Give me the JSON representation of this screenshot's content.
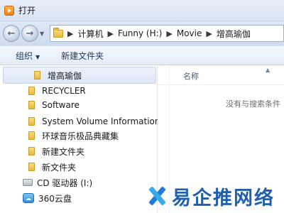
{
  "window": {
    "title": "打开"
  },
  "address": {
    "crumbs": [
      "计算机",
      "Funny (H:)",
      "Movie",
      "增高瑜伽"
    ]
  },
  "toolbar": {
    "organize_label": "组织",
    "new_folder_label": "新建文件夹"
  },
  "nav": {
    "items": [
      {
        "label": "增高瑜伽",
        "icon": "folder-icon",
        "selected": true
      },
      {
        "label": "RECYCLER",
        "icon": "folder-icon"
      },
      {
        "label": "Software",
        "icon": "folder-icon"
      },
      {
        "label": "System Volume Information",
        "icon": "folder-icon"
      },
      {
        "label": "环球音乐极品典藏集",
        "icon": "folder-icon"
      },
      {
        "label": "新建文件夹",
        "icon": "folder-icon"
      },
      {
        "label": "新文件夹",
        "icon": "folder-icon"
      },
      {
        "label": "CD 驱动器 (I:)",
        "icon": "cd-drive-icon"
      },
      {
        "label": "360云盘",
        "icon": "cloud-drive-icon"
      }
    ]
  },
  "content": {
    "column_name": "名称",
    "empty_message": "没有与搜索条件"
  },
  "watermark": {
    "text": "易企推网络"
  },
  "colors": {
    "titlebar": "#dde8f6",
    "selection": "#dce7f5",
    "watermark": "#1f5fb0"
  }
}
